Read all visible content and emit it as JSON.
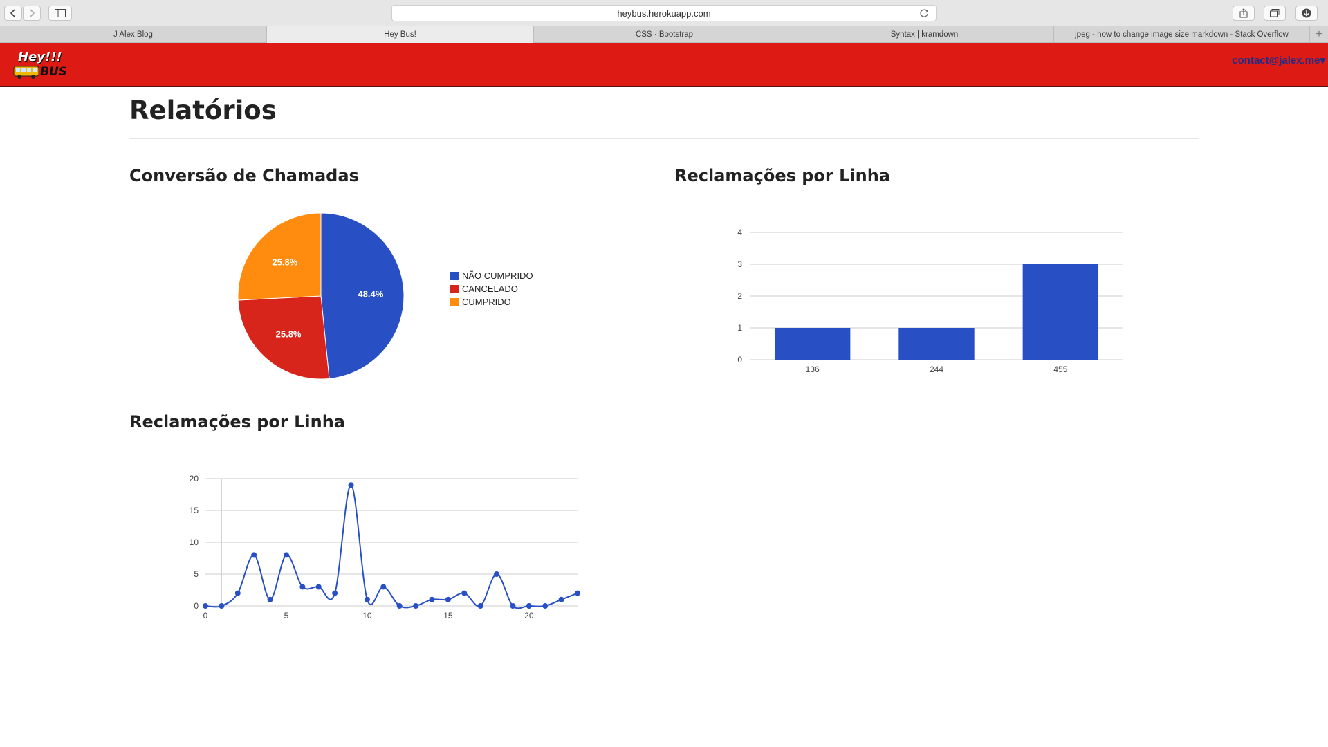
{
  "browser": {
    "url": "heybus.herokuapp.com",
    "tabs": [
      {
        "label": "J Alex Blog"
      },
      {
        "label": "Hey Bus!"
      },
      {
        "label": "CSS · Bootstrap"
      },
      {
        "label": "Syntax | kramdown"
      },
      {
        "label": "jpeg - how to change image size markdown - Stack Overflow"
      }
    ],
    "active_tab": 1
  },
  "header": {
    "logo_line1": "Hey!!!",
    "logo_line2": "BUS",
    "contact": "contact@jalex.me"
  },
  "page": {
    "title": "Relatórios"
  },
  "colors": {
    "brand_red": "#de1a14",
    "blue": "#2850c4",
    "red": "#d8251c",
    "orange": "#ff8c0e"
  },
  "chart_data": [
    {
      "type": "pie",
      "title": "Conversão de Chamadas",
      "slices": [
        {
          "label": "NÃO CUMPRIDO",
          "value": 48.4,
          "display": "48.4%",
          "color": "#2850c4"
        },
        {
          "label": "CANCELADO",
          "value": 25.8,
          "display": "25.8%",
          "color": "#d8251c"
        },
        {
          "label": "CUMPRIDO",
          "value": 25.8,
          "display": "25.8%",
          "color": "#ff8c0e"
        }
      ],
      "legend": "right"
    },
    {
      "type": "bar",
      "title": "Reclamações por Linha",
      "categories": [
        "136",
        "244",
        "455"
      ],
      "values": [
        1,
        1,
        3
      ],
      "ylim": [
        0,
        4
      ],
      "yticks": [
        0,
        1,
        2,
        3,
        4
      ],
      "color": "#2850c4",
      "grid": true
    },
    {
      "type": "line",
      "title": "Reclamações por Linha",
      "x": [
        0,
        1,
        2,
        3,
        4,
        5,
        6,
        7,
        8,
        9,
        10,
        11,
        12,
        13,
        14,
        15,
        16,
        17,
        18,
        19,
        20,
        21,
        22,
        23
      ],
      "y": [
        0,
        0,
        2,
        8,
        1,
        8,
        3,
        3,
        2,
        19,
        1,
        3,
        0,
        0,
        1,
        1,
        2,
        0,
        5,
        0,
        0,
        0,
        1,
        2
      ],
      "xlim": [
        0,
        23
      ],
      "ylim": [
        0,
        20
      ],
      "xticks": [
        0,
        5,
        10,
        15,
        20
      ],
      "yticks": [
        0,
        5,
        10,
        15,
        20
      ],
      "color": "#2850c4",
      "grid": true,
      "smooth": true
    }
  ]
}
